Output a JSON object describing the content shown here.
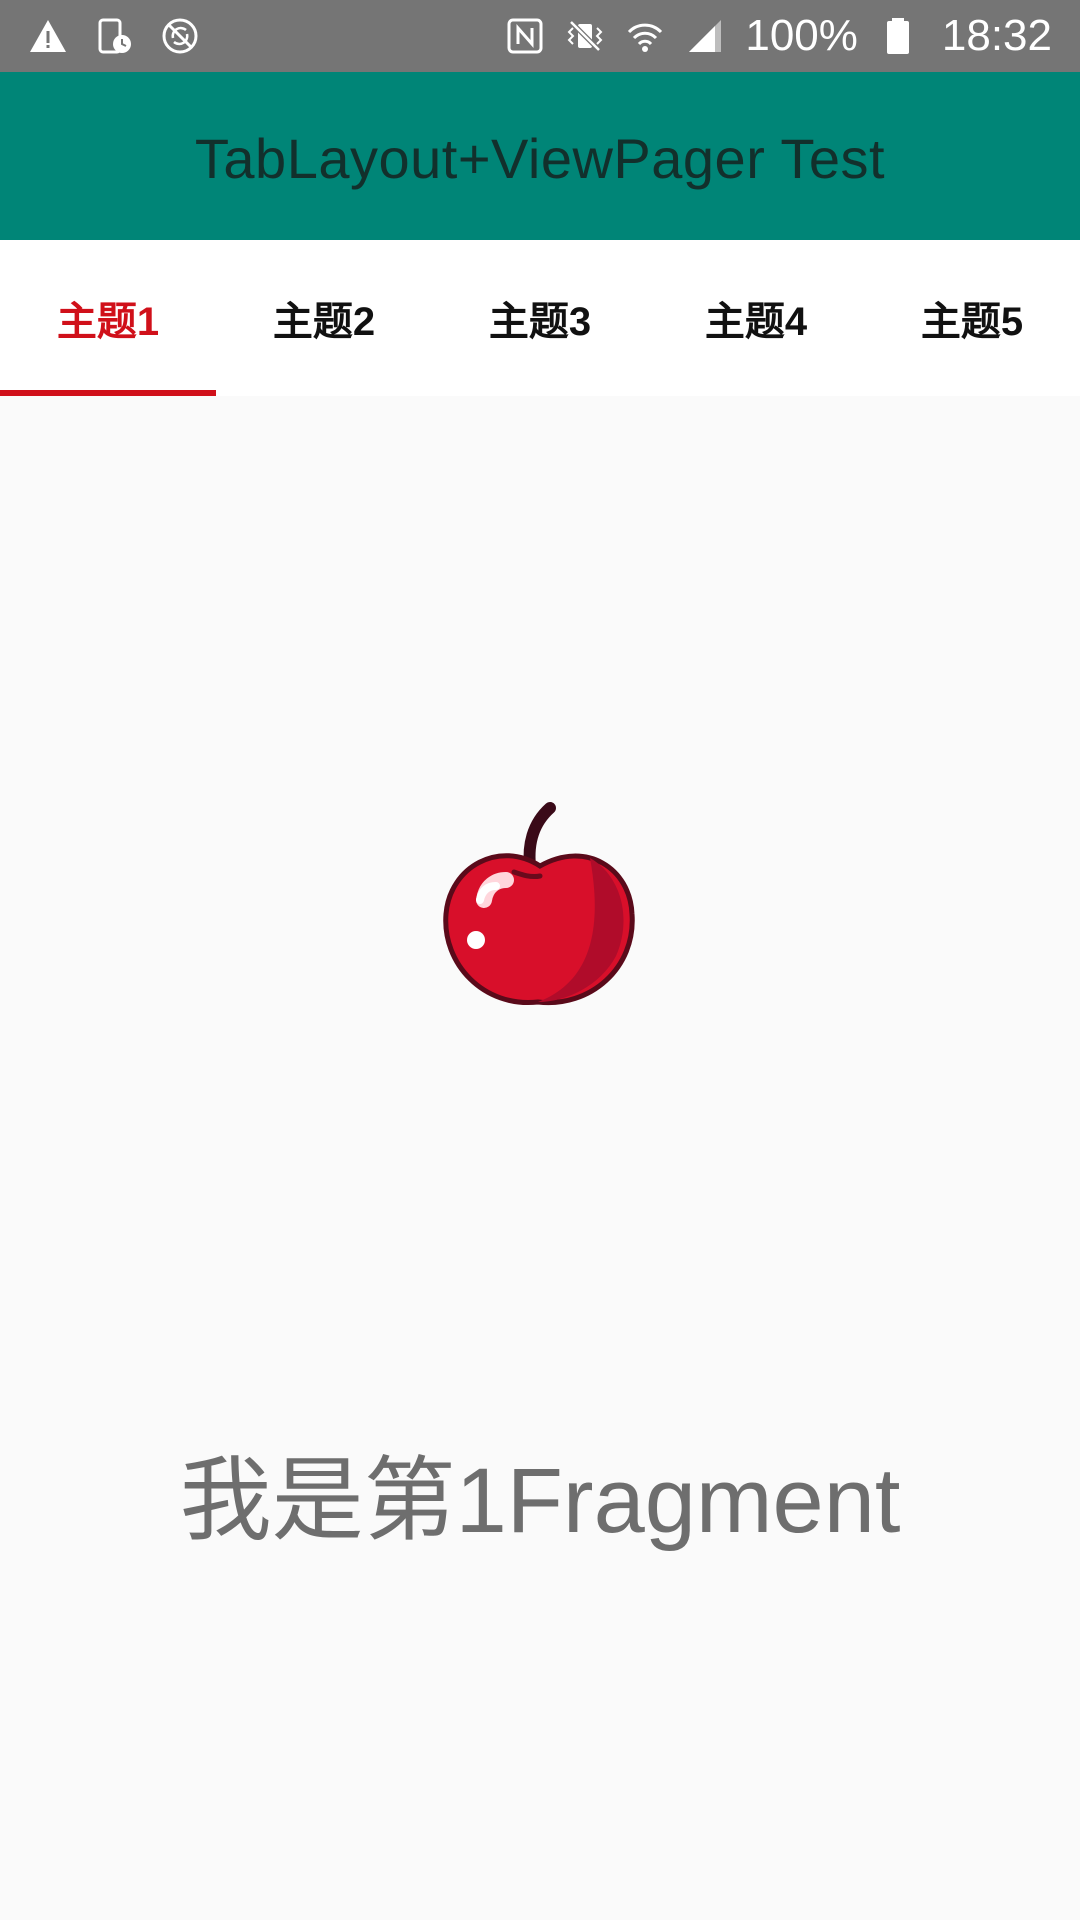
{
  "status_bar": {
    "left_icons": [
      "warning-icon",
      "device-clock-icon",
      "no-sync-icon"
    ],
    "right_icons": [
      "nfc-icon",
      "vibrate-icon",
      "wifi-icon",
      "signal-icon",
      "battery-icon"
    ],
    "battery_percent": "100%",
    "time": "18:32"
  },
  "app_bar": {
    "title": "TabLayout+ViewPager Test",
    "background_color": "#008577"
  },
  "tabs": {
    "active_color": "#d0101a",
    "selected_index": 0,
    "items": [
      {
        "label": "主题1"
      },
      {
        "label": "主题2"
      },
      {
        "label": "主题3"
      },
      {
        "label": "主题4"
      },
      {
        "label": "主题5"
      }
    ]
  },
  "content": {
    "image_icon": "apple-icon",
    "text": "我是第1Fragment"
  }
}
